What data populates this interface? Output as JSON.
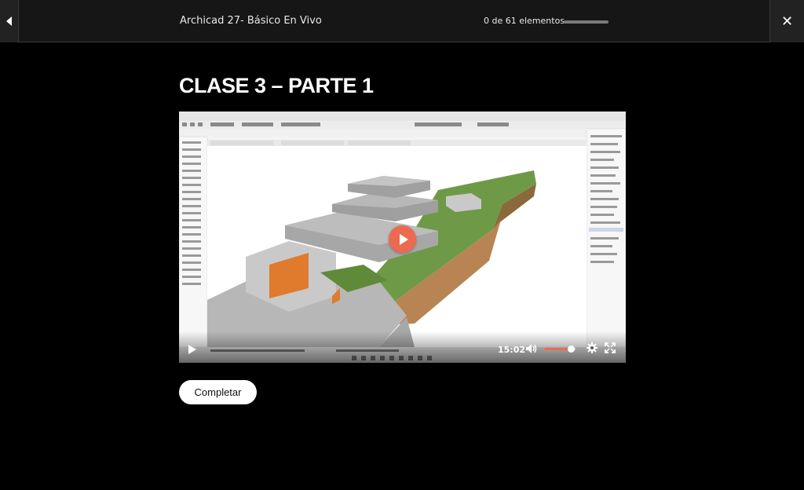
{
  "header": {
    "back_icon": "chevron-left-icon",
    "course_title": "Archicad 27- Básico En Vivo",
    "progress_text": "0 de 61 elementos",
    "progress_fraction": 0,
    "close_icon": "close-icon"
  },
  "lesson": {
    "title": "CLASE 3 – PARTE 1"
  },
  "video": {
    "duration": "15:02",
    "volume_fraction": 0.85,
    "accent_color": "#ec6a52",
    "icons": [
      "play-icon",
      "volume-icon",
      "gear-icon",
      "fullscreen-icon"
    ]
  },
  "actions": {
    "complete_label": "Completar"
  }
}
